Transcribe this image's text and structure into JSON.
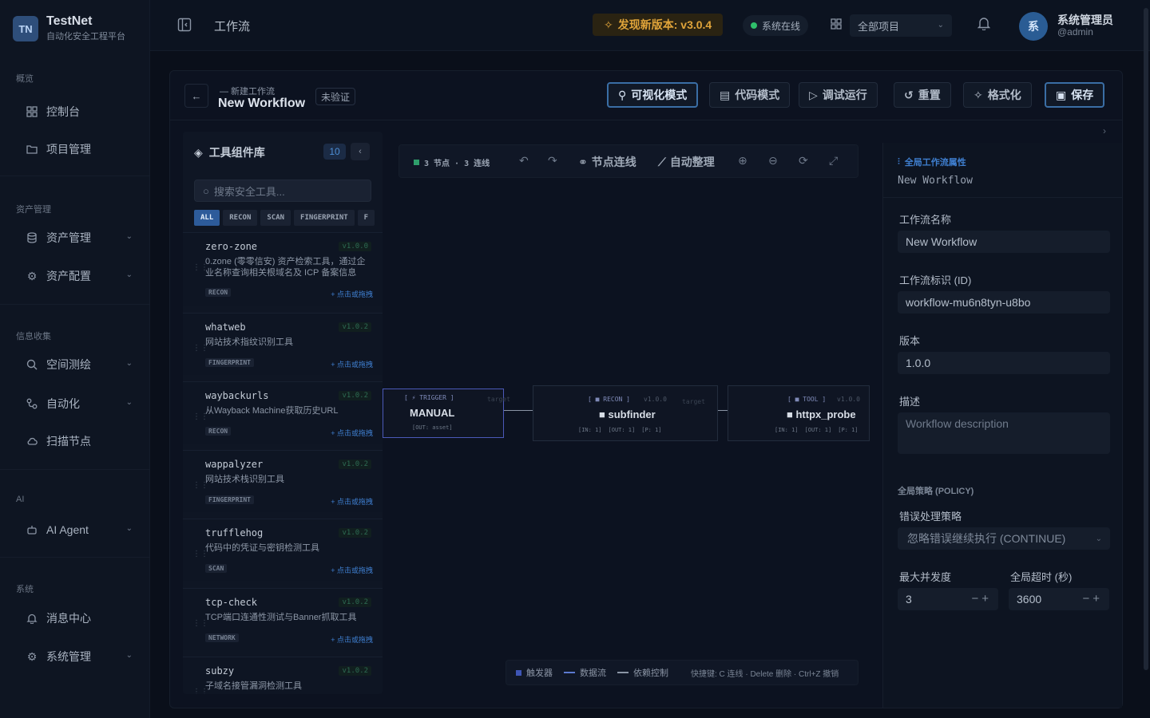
{
  "brand": {
    "logo": "TN",
    "name": "TestNet",
    "subtitle": "自动化安全工程平台"
  },
  "sidebar": {
    "sections": [
      {
        "label": "概览"
      },
      {
        "label": "资产管理"
      },
      {
        "label": "信息收集"
      },
      {
        "label": "AI"
      },
      {
        "label": "系统"
      }
    ],
    "items": [
      {
        "label": "控制台",
        "icon": "dashboard-icon"
      },
      {
        "label": "项目管理",
        "icon": "folder-icon"
      },
      {
        "label": "资产管理",
        "icon": "database-icon"
      },
      {
        "label": "资产配置",
        "icon": "gear-icon"
      },
      {
        "label": "空间测绘",
        "icon": "search-icon"
      },
      {
        "label": "自动化",
        "icon": "workflow-icon"
      },
      {
        "label": "扫描节点",
        "icon": "cloud-icon"
      },
      {
        "label": "AI Agent",
        "icon": "robot-icon"
      },
      {
        "label": "消息中心",
        "icon": "bell-icon"
      },
      {
        "label": "系统管理",
        "icon": "gear-icon"
      }
    ]
  },
  "topbar": {
    "page_title": "工作流",
    "update_label": "发现新版本: v3.0.4",
    "status_label": "系统在线",
    "project_select": "全部项目",
    "user_avatar": "系",
    "user_name": "系统管理员",
    "user_handle": "@admin"
  },
  "editor": {
    "subtitle": "— 新建工作流",
    "name": "New Workflow",
    "badge": "未验证",
    "buttons": {
      "visual": "可视化模式",
      "code": "代码模式",
      "debug": "调试运行",
      "reset": "重置",
      "format": "格式化",
      "save": "保存"
    }
  },
  "library": {
    "title": "工具组件库",
    "count": "10",
    "search_placeholder": "搜索安全工具...",
    "tabs": [
      "ALL",
      "RECON",
      "SCAN",
      "FINGERPRINT",
      "F"
    ],
    "drag_hint": "+ 点击或拖拽",
    "tools": [
      {
        "name": "zero-zone",
        "version": "v1.0.0",
        "desc": "0.zone (零零信安) 资产检索工具，通过企业名称查询相关根域名及 ICP 备案信息",
        "category": "RECON"
      },
      {
        "name": "whatweb",
        "version": "v1.0.2",
        "desc": "网站技术指纹识别工具",
        "category": "FINGERPRINT"
      },
      {
        "name": "waybackurls",
        "version": "v1.0.2",
        "desc": "从Wayback Machine获取历史URL",
        "category": "RECON"
      },
      {
        "name": "wappalyzer",
        "version": "v1.0.2",
        "desc": "网站技术栈识别工具",
        "category": "FINGERPRINT"
      },
      {
        "name": "trufflehog",
        "version": "v1.0.2",
        "desc": "代码中的凭证与密钥检测工具",
        "category": "SCAN"
      },
      {
        "name": "tcp-check",
        "version": "v1.0.2",
        "desc": "TCP端口连通性测试与Banner抓取工具",
        "category": "NETWORK"
      },
      {
        "name": "subzy",
        "version": "v1.0.2",
        "desc": "子域名接管漏洞检测工具",
        "category": ""
      }
    ]
  },
  "canvas": {
    "stats": "3 节点 · 3 连线",
    "connect_label": "节点连线",
    "arrange_label": "自动整理",
    "nodes": [
      {
        "tag": "[ ⚡ TRIGGER ]",
        "name": "MANUAL",
        "version": "",
        "target": "target",
        "io": [
          "[OUT: asset]"
        ]
      },
      {
        "tag": "[ ■ RECON ]",
        "name": "■ subfinder",
        "version": "v1.0.0",
        "target": "target",
        "io": [
          "[IN: 1]",
          "[OUT: 1]",
          "[P: 1]"
        ]
      },
      {
        "tag": "[ ■ TOOL ]",
        "name": "■ httpx_probe",
        "version": "v1.0.0",
        "target": "",
        "io": [
          "[IN: 1]",
          "[OUT: 1]",
          "[P: 1]"
        ]
      }
    ],
    "legend": {
      "trigger": "触发器",
      "dataflow": "数据流",
      "dependency": "依赖控制",
      "hint": "快捷键: C 连线 · Delete 删除 · Ctrl+Z 撤销"
    }
  },
  "props": {
    "title": "全局工作流属性",
    "subtitle": "New Workflow",
    "name_label": "工作流名称",
    "name_value": "New Workflow",
    "id_label": "工作流标识 (ID)",
    "id_value": "workflow-mu6n8tyn-u8bo",
    "version_label": "版本",
    "version_value": "1.0.0",
    "desc_label": "描述",
    "desc_placeholder": "Workflow description",
    "policy_title": "全局策略 (POLICY)",
    "error_label": "错误处理策略",
    "error_value": "忽略错误继续执行 (CONTINUE)",
    "concurrency_label": "最大并发度",
    "concurrency_value": "3",
    "timeout_label": "全局超时 (秒)",
    "timeout_value": "3600"
  },
  "colors": {
    "accent": "#3a6ea5",
    "update": "#e0a43a",
    "online": "#2fbf6b",
    "version": "#2d6b52"
  }
}
